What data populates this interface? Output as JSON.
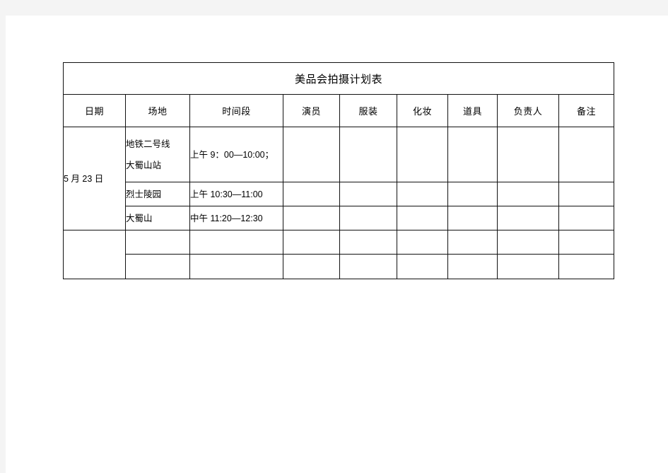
{
  "document": {
    "title": "美品会拍摄计划表"
  },
  "table": {
    "headers": [
      {
        "key": "date",
        "label": "日期"
      },
      {
        "key": "venue",
        "label": "场地"
      },
      {
        "key": "time",
        "label": "时间段"
      },
      {
        "key": "actor",
        "label": "演员"
      },
      {
        "key": "cloth",
        "label": "服装"
      },
      {
        "key": "makeup",
        "label": "化妆"
      },
      {
        "key": "props",
        "label": "道具"
      },
      {
        "key": "owner",
        "label": "负责人"
      },
      {
        "key": "note",
        "label": "备注"
      }
    ],
    "rows": [
      {
        "date": "5 月 23 日",
        "venue_line1": "地铁二号线",
        "venue_line2": "大蜀山站",
        "time": "上午 9：00—10:00；",
        "actor": "",
        "cloth": "",
        "makeup": "",
        "props": "",
        "owner": "",
        "note": ""
      },
      {
        "date": "",
        "venue_line1": "烈士陵园",
        "venue_line2": "",
        "time": "上午 10:30—11:00",
        "actor": "",
        "cloth": "",
        "makeup": "",
        "props": "",
        "owner": "",
        "note": ""
      },
      {
        "date": "",
        "venue_line1": "大蜀山",
        "venue_line2": "",
        "time": "中午 11:20—12:30",
        "actor": "",
        "cloth": "",
        "makeup": "",
        "props": "",
        "owner": "",
        "note": ""
      },
      {
        "date": "",
        "venue_line1": "",
        "venue_line2": "",
        "time": "",
        "actor": "",
        "cloth": "",
        "makeup": "",
        "props": "",
        "owner": "",
        "note": ""
      },
      {
        "date": "",
        "venue_line1": "",
        "venue_line2": "",
        "time": "",
        "actor": "",
        "cloth": "",
        "makeup": "",
        "props": "",
        "owner": "",
        "note": ""
      }
    ]
  },
  "colors": {
    "page_background": "#ffffff",
    "outer_background": "#f4f4f4",
    "border": "#111111",
    "text": "#000000"
  }
}
